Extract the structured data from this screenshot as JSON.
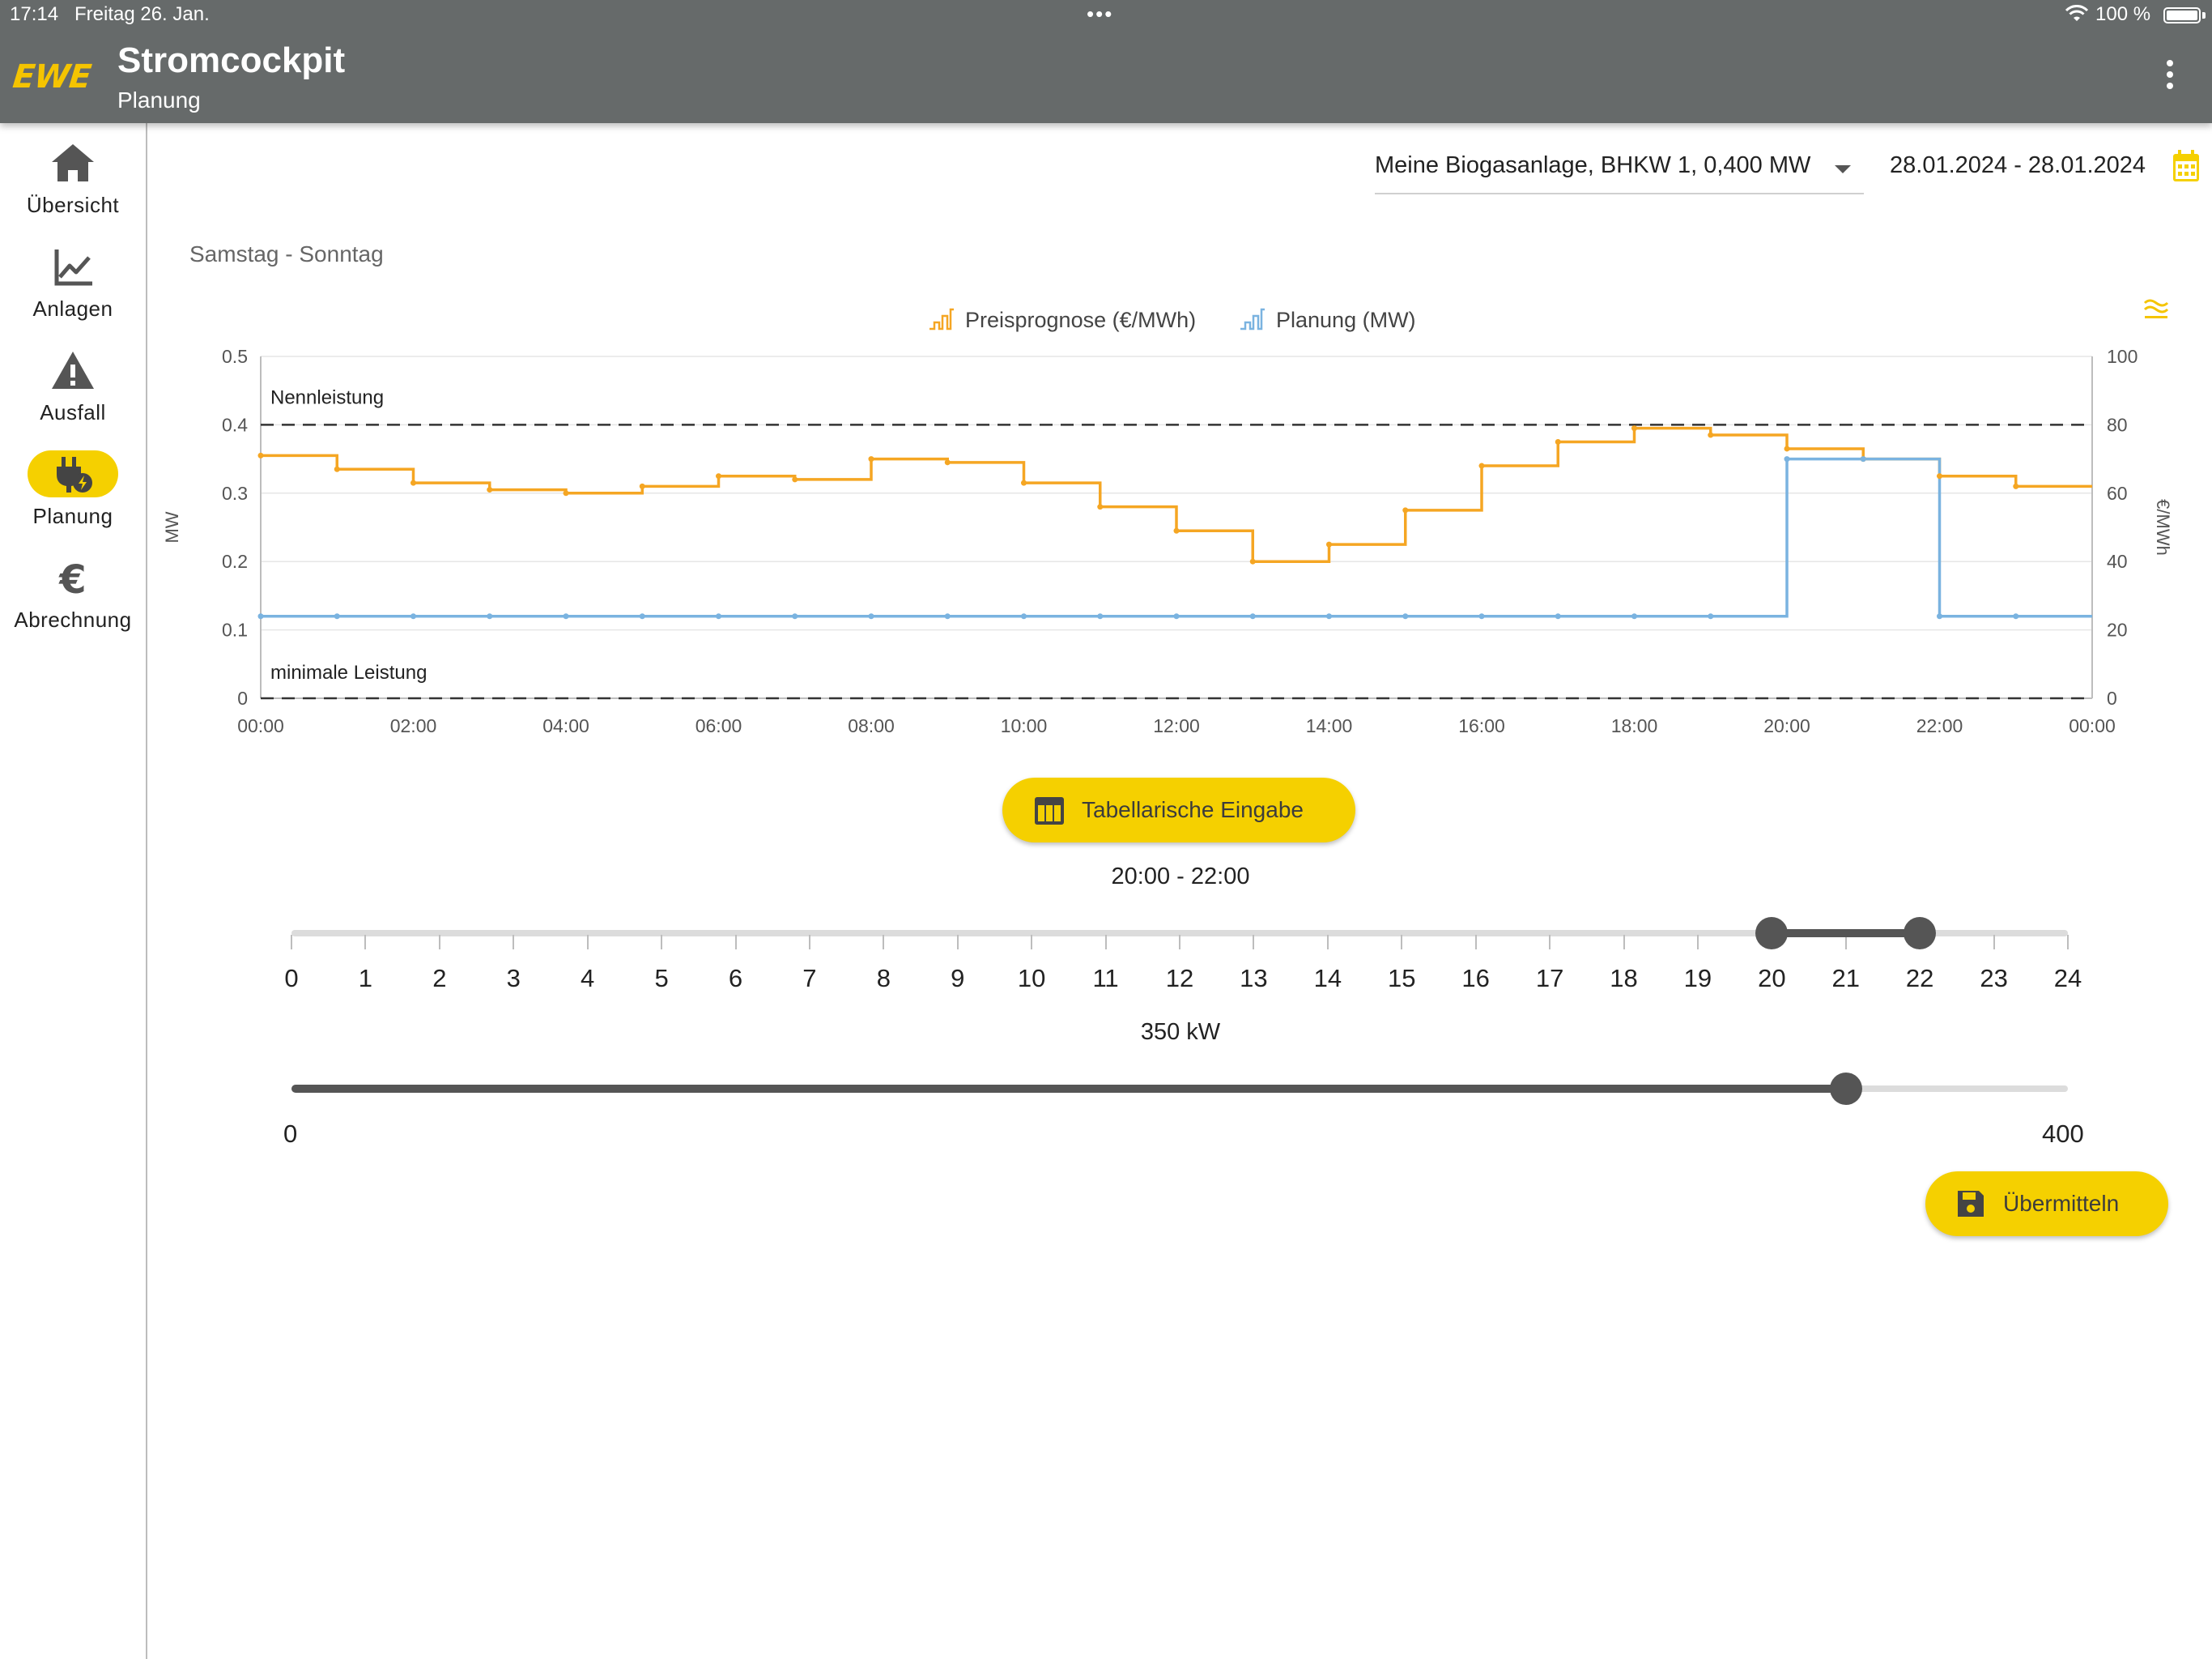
{
  "status_bar": {
    "time": "17:14",
    "date": "Freitag 26. Jan.",
    "battery": "100 %",
    "dots": "•••"
  },
  "app_bar": {
    "logo": "EWE",
    "title": "Stromcockpit",
    "subtitle": "Planung"
  },
  "nav": {
    "items": [
      {
        "label": "Übersicht",
        "icon": "home-icon"
      },
      {
        "label": "Anlagen",
        "icon": "chart-line-icon"
      },
      {
        "label": "Ausfall",
        "icon": "warning-icon"
      },
      {
        "label": "Planung",
        "icon": "plug-icon",
        "active": true
      },
      {
        "label": "Abrechnung",
        "icon": "euro-icon"
      }
    ]
  },
  "toolbar": {
    "plant_select": "Meine Biogasanlage, BHKW 1, 0,400 MW",
    "date_range": "28.01.2024 - 28.01.2024"
  },
  "day_label": "Samstag - Sonntag",
  "colors": {
    "accent": "#f5d000",
    "price_line": "#f5a623",
    "plan_line": "#7ab3e0",
    "dark": "#555555"
  },
  "chart_data": {
    "type": "line",
    "legend": [
      "Preisprognose (€/MWh)",
      "Planung (MW)"
    ],
    "x_ticks": [
      "00:00",
      "02:00",
      "04:00",
      "06:00",
      "08:00",
      "10:00",
      "12:00",
      "14:00",
      "16:00",
      "18:00",
      "20:00",
      "22:00",
      "00:00"
    ],
    "left_axis": {
      "label": "MW",
      "ticks": [
        "0",
        "0.1",
        "0.2",
        "0.3",
        "0.4",
        "0.5"
      ],
      "range": [
        0,
        0.5
      ]
    },
    "right_axis": {
      "label": "€/MWh",
      "ticks": [
        "0",
        "20",
        "40",
        "60",
        "80",
        "100"
      ],
      "range": [
        0,
        100
      ]
    },
    "reference_lines": [
      {
        "label": "Nennleistung",
        "value": 0.4
      },
      {
        "label": "minimale Leistung",
        "value": 0
      }
    ],
    "series": [
      {
        "name": "Preisprognose (€/MWh)",
        "axis": "right",
        "step": true,
        "values": [
          71,
          67,
          63,
          61,
          60,
          62,
          65,
          64,
          70,
          69,
          63,
          56,
          49,
          40,
          45,
          55,
          68,
          75,
          79,
          77,
          73,
          70,
          65,
          62
        ]
      },
      {
        "name": "Planung (MW)",
        "axis": "left",
        "step": true,
        "values": [
          0.12,
          0.12,
          0.12,
          0.12,
          0.12,
          0.12,
          0.12,
          0.12,
          0.12,
          0.12,
          0.12,
          0.12,
          0.12,
          0.12,
          0.12,
          0.12,
          0.12,
          0.12,
          0.12,
          0.12,
          0.35,
          0.35,
          0.12,
          0.12
        ]
      }
    ]
  },
  "buttons": {
    "table_input": "Tabellarische Eingabe",
    "submit": "Übermitteln"
  },
  "time_slider": {
    "label": "20:00 - 22:00",
    "min": 0,
    "max": 24,
    "from": 20,
    "to": 22,
    "tick_labels": [
      "0",
      "1",
      "2",
      "3",
      "4",
      "5",
      "6",
      "7",
      "8",
      "9",
      "10",
      "11",
      "12",
      "13",
      "14",
      "15",
      "16",
      "17",
      "18",
      "19",
      "20",
      "21",
      "22",
      "23",
      "24"
    ]
  },
  "power_slider": {
    "label": "350 kW",
    "min": 0,
    "max": 400,
    "value": 350,
    "min_label": "0",
    "max_label": "400"
  }
}
